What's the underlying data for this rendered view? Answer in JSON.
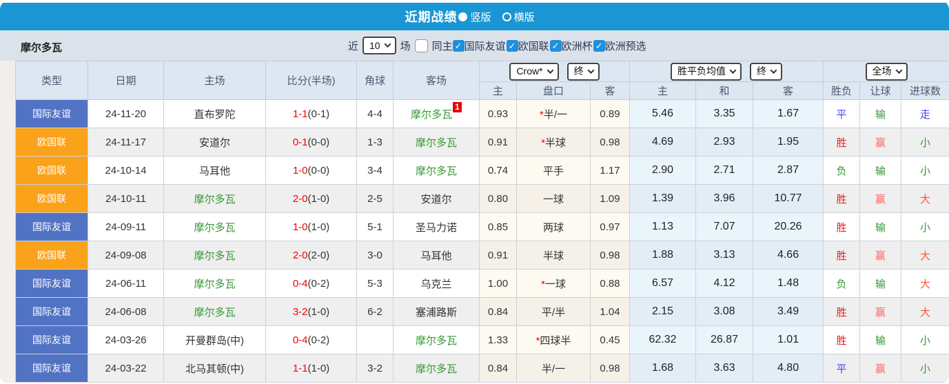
{
  "colors": {
    "bar": "#1b96d5",
    "filter_bg": "#dce2ea",
    "header_bg": "#dde7f2",
    "badge_blue": "#5273c4",
    "badge_orange": "#f9a21a",
    "team_green": "#339933",
    "score_red": "#f20000",
    "res_red": "#e62222",
    "res_green": "#2e8b3a",
    "res_blue": "#4646ff",
    "res_pink": "#ff6666",
    "res_orange": "#ff5430",
    "odds_bg": "#fdfaf2",
    "odds_bg_alt": "#f5f1e8",
    "avg_bg": "#eaf4fb",
    "avg_bg_alt": "#e2edf6",
    "row_alt": "#efefef",
    "check_blue": "#1e90dd"
  },
  "title_bar": {
    "title": "近期战绩",
    "radio_vertical": "竖版",
    "radio_horizontal": "横版"
  },
  "filter_bar": {
    "team_name": "摩尔多瓦",
    "recent_label": "近",
    "recent_count": "10",
    "games_label": "场",
    "same_home_label": "同主",
    "competitions": [
      "国际友谊",
      "欧国联",
      "欧洲杯",
      "欧洲预选"
    ]
  },
  "table": {
    "columns": [
      "类型",
      "日期",
      "主场",
      "比分(半场)",
      "角球",
      "客场"
    ],
    "sub_columns": [
      "主",
      "盘口",
      "客",
      "主",
      "和",
      "客",
      "胜负",
      "让球",
      "进球数"
    ],
    "selects": {
      "company": "Crow*",
      "company_time": "终",
      "avg": "胜平负均值",
      "avg_time": "终",
      "scope": "全场"
    },
    "rows": [
      {
        "type": "国际友谊",
        "type_color": "blue",
        "date": "24-11-20",
        "home": "直布罗陀",
        "home_class": "",
        "score": "1-1",
        "half": "(0-1)",
        "corners": "4-4",
        "away": "摩尔多瓦",
        "away_class": "green",
        "away_badge": "1",
        "odds_home": "0.93",
        "handicap_star": "*",
        "handicap": "半/一",
        "odds_away": "0.89",
        "avg_home": "5.46",
        "avg_draw": "3.35",
        "avg_away": "1.67",
        "res_wdl": "平",
        "res_wdl_color": "blue",
        "res_handicap": "输",
        "res_hcp_color": "green",
        "res_goals": "走",
        "res_goal_color": "blue"
      },
      {
        "type": "欧国联",
        "type_color": "orange",
        "date": "24-11-17",
        "home": "安道尔",
        "home_class": "",
        "score": "0-1",
        "half": "(0-0)",
        "corners": "1-3",
        "away": "摩尔多瓦",
        "away_class": "green",
        "away_badge": "",
        "odds_home": "0.91",
        "handicap_star": "*",
        "handicap": "半球",
        "odds_away": "0.98",
        "avg_home": "4.69",
        "avg_draw": "2.93",
        "avg_away": "1.95",
        "res_wdl": "胜",
        "res_wdl_color": "red",
        "res_handicap": "赢",
        "res_hcp_color": "pink",
        "res_goals": "小",
        "res_goal_color": "green"
      },
      {
        "type": "欧国联",
        "type_color": "orange",
        "date": "24-10-14",
        "home": "马耳他",
        "home_class": "",
        "score": "1-0",
        "half": "(0-0)",
        "corners": "3-4",
        "away": "摩尔多瓦",
        "away_class": "green",
        "away_badge": "",
        "odds_home": "0.74",
        "handicap_star": "",
        "handicap": "平手",
        "odds_away": "1.17",
        "avg_home": "2.90",
        "avg_draw": "2.71",
        "avg_away": "2.87",
        "res_wdl": "负",
        "res_wdl_color": "green",
        "res_handicap": "输",
        "res_hcp_color": "green",
        "res_goals": "小",
        "res_goal_color": "green"
      },
      {
        "type": "欧国联",
        "type_color": "orange",
        "date": "24-10-11",
        "home": "摩尔多瓦",
        "home_class": "green",
        "score": "2-0",
        "half": "(1-0)",
        "corners": "2-5",
        "away": "安道尔",
        "away_class": "",
        "away_badge": "",
        "odds_home": "0.80",
        "handicap_star": "",
        "handicap": "一球",
        "odds_away": "1.09",
        "avg_home": "1.39",
        "avg_draw": "3.96",
        "avg_away": "10.77",
        "res_wdl": "胜",
        "res_wdl_color": "red",
        "res_handicap": "赢",
        "res_hcp_color": "pink",
        "res_goals": "大",
        "res_goal_color": "orange"
      },
      {
        "type": "国际友谊",
        "type_color": "blue",
        "date": "24-09-11",
        "home": "摩尔多瓦",
        "home_class": "green",
        "score": "1-0",
        "half": "(1-0)",
        "corners": "5-1",
        "away": "圣马力诺",
        "away_class": "",
        "away_badge": "",
        "odds_home": "0.85",
        "handicap_star": "",
        "handicap": "两球",
        "odds_away": "0.97",
        "avg_home": "1.13",
        "avg_draw": "7.07",
        "avg_away": "20.26",
        "res_wdl": "胜",
        "res_wdl_color": "red",
        "res_handicap": "输",
        "res_hcp_color": "green",
        "res_goals": "小",
        "res_goal_color": "green"
      },
      {
        "type": "欧国联",
        "type_color": "orange",
        "date": "24-09-08",
        "home": "摩尔多瓦",
        "home_class": "green",
        "score": "2-0",
        "half": "(2-0)",
        "corners": "3-0",
        "away": "马耳他",
        "away_class": "",
        "away_badge": "",
        "odds_home": "0.91",
        "handicap_star": "",
        "handicap": "半球",
        "odds_away": "0.98",
        "avg_home": "1.88",
        "avg_draw": "3.13",
        "avg_away": "4.66",
        "res_wdl": "胜",
        "res_wdl_color": "red",
        "res_handicap": "赢",
        "res_hcp_color": "pink",
        "res_goals": "大",
        "res_goal_color": "orange"
      },
      {
        "type": "国际友谊",
        "type_color": "blue",
        "date": "24-06-11",
        "home": "摩尔多瓦",
        "home_class": "green",
        "score": "0-4",
        "half": "(0-2)",
        "corners": "5-3",
        "away": "乌克兰",
        "away_class": "",
        "away_badge": "",
        "odds_home": "1.00",
        "handicap_star": "*",
        "handicap": "一球",
        "odds_away": "0.88",
        "avg_home": "6.57",
        "avg_draw": "4.12",
        "avg_away": "1.48",
        "res_wdl": "负",
        "res_wdl_color": "green",
        "res_handicap": "输",
        "res_hcp_color": "green",
        "res_goals": "大",
        "res_goal_color": "orange"
      },
      {
        "type": "国际友谊",
        "type_color": "blue",
        "date": "24-06-08",
        "home": "摩尔多瓦",
        "home_class": "green",
        "score": "3-2",
        "half": "(1-0)",
        "corners": "6-2",
        "away": "塞浦路斯",
        "away_class": "",
        "away_badge": "",
        "odds_home": "0.84",
        "handicap_star": "",
        "handicap": "平/半",
        "odds_away": "1.04",
        "avg_home": "2.15",
        "avg_draw": "3.08",
        "avg_away": "3.49",
        "res_wdl": "胜",
        "res_wdl_color": "red",
        "res_handicap": "赢",
        "res_hcp_color": "pink",
        "res_goals": "大",
        "res_goal_color": "orange"
      },
      {
        "type": "国际友谊",
        "type_color": "blue",
        "date": "24-03-26",
        "home": "开曼群岛(中)",
        "home_class": "",
        "score": "0-4",
        "half": "(0-2)",
        "corners": "",
        "away": "摩尔多瓦",
        "away_class": "green",
        "away_badge": "",
        "odds_home": "1.33",
        "handicap_star": "*",
        "handicap": "四球半",
        "odds_away": "0.45",
        "avg_home": "62.32",
        "avg_draw": "26.87",
        "avg_away": "1.01",
        "res_wdl": "胜",
        "res_wdl_color": "red",
        "res_handicap": "输",
        "res_hcp_color": "green",
        "res_goals": "小",
        "res_goal_color": "green"
      },
      {
        "type": "国际友谊",
        "type_color": "blue",
        "date": "24-03-22",
        "home": "北马其顿(中)",
        "home_class": "",
        "score": "1-1",
        "half": "(1-0)",
        "corners": "3-2",
        "away": "摩尔多瓦",
        "away_class": "green",
        "away_badge": "",
        "odds_home": "0.84",
        "handicap_star": "",
        "handicap": "半/一",
        "odds_away": "0.98",
        "avg_home": "1.68",
        "avg_draw": "3.63",
        "avg_away": "4.80",
        "res_wdl": "平",
        "res_wdl_color": "blue",
        "res_handicap": "赢",
        "res_hcp_color": "pink",
        "res_goals": "小",
        "res_goal_color": "green"
      }
    ]
  }
}
